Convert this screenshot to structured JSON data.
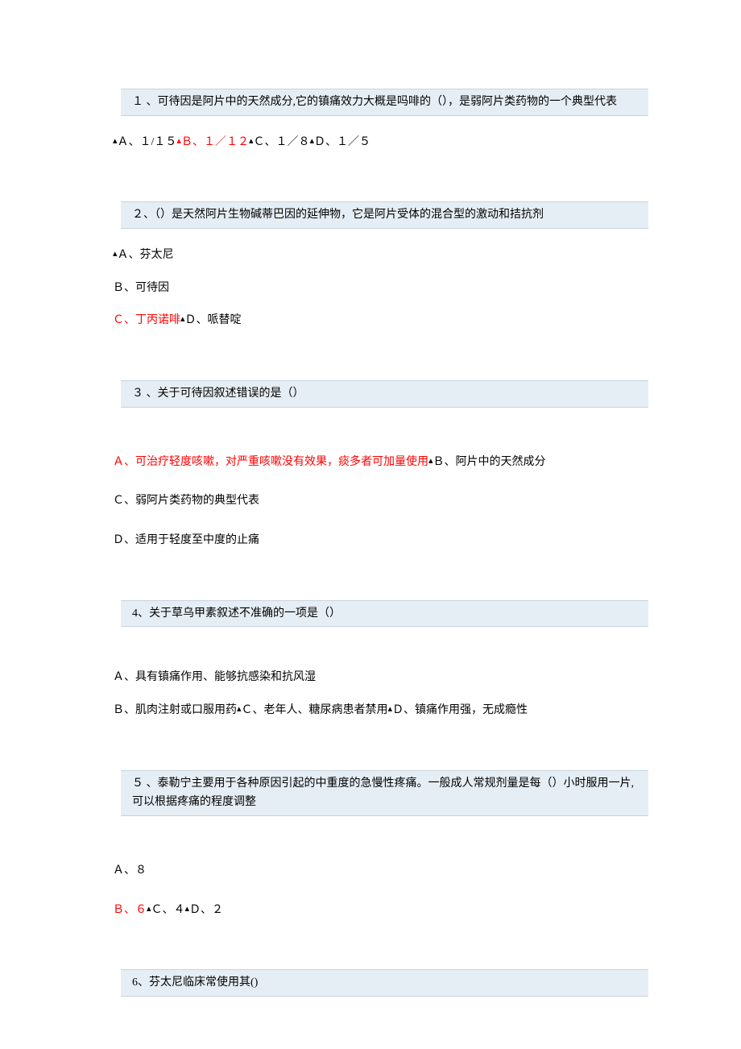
{
  "questions": [
    {
      "stem": "１ 、可待因是阿片中的天然成分,它的镇痛效力大概是吗啡的（），是弱阿片类药物的一个典型代表",
      "options": [
        {
          "marker": "▴",
          "label": "Ａ、１/１５",
          "correct": false
        },
        {
          "marker": "▴",
          "label": "Ｂ、１／１２",
          "correct": true
        },
        {
          "marker": "▴",
          "label": "Ｃ、１／８",
          "correct": false
        },
        {
          "marker": "▴",
          "label": "Ｄ、１／５",
          "correct": false
        }
      ]
    },
    {
      "stem": "２、（）是天然阿片生物碱蒂巴因的延伸物，它是阿片受体的混合型的激动和拮抗剂",
      "options_block1": [
        {
          "marker": "▴",
          "label": "Ａ、芬太尼",
          "correct": false
        }
      ],
      "options_block2": [
        {
          "marker": "",
          "label": "Ｂ、可待因",
          "correct": false
        }
      ],
      "options_block3": [
        {
          "marker": "",
          "label": "Ｃ、丁丙诺啡",
          "correct": true
        },
        {
          "marker": "▴",
          "label": "Ｄ、哌替啶",
          "correct": false
        }
      ]
    },
    {
      "stem": "３ 、关于可待因叙述错误的是（）",
      "options_row1": [
        {
          "marker": "",
          "label": "Ａ、可治疗轻度咳嗽，对严重咳嗽没有效果，痰多者可加量使用",
          "correct": true
        },
        {
          "marker": "▴",
          "label": "Ｂ、阿片中的天然成分",
          "correct": false
        }
      ],
      "options_row2": {
        "marker": "",
        "label": "Ｃ、弱阿片类药物的典型代表",
        "correct": false
      },
      "options_row3": {
        "marker": "",
        "label": "Ｄ、适用于轻度至中度的止痛",
        "correct": false
      }
    },
    {
      "stem": "4、关于草乌甲素叙述不准确的一项是（）",
      "options_row1": {
        "marker": "",
        "label": "Ａ、具有镇痛作用、能够抗感染和抗风湿",
        "correct": false
      },
      "options_row2": [
        {
          "marker": "",
          "label": "Ｂ、肌肉注射或口服用药",
          "correct": false
        },
        {
          "marker": "▴",
          "label": "Ｃ、老年人、糖尿病患者禁用",
          "correct": false
        },
        {
          "marker": "▴",
          "label": "Ｄ、镇痛作用强，无成瘾性",
          "correct": false
        }
      ]
    },
    {
      "stem": "５ 、泰勒宁主要用于各种原因引起的中重度的急慢性疼痛。一般成人常规剂量是每（）小时服用一片,可以根据疼痛的程度调整",
      "options_row1": {
        "marker": "",
        "label": "Ａ、８",
        "correct": false
      },
      "options_row2": [
        {
          "marker": "",
          "label": "Ｂ、６",
          "correct": true
        },
        {
          "marker": "▴",
          "label": "Ｃ、４",
          "correct": false
        },
        {
          "marker": "▴",
          "label": "Ｄ、２",
          "correct": false
        }
      ]
    },
    {
      "stem": "6、芬太尼临床常使用其()"
    }
  ]
}
